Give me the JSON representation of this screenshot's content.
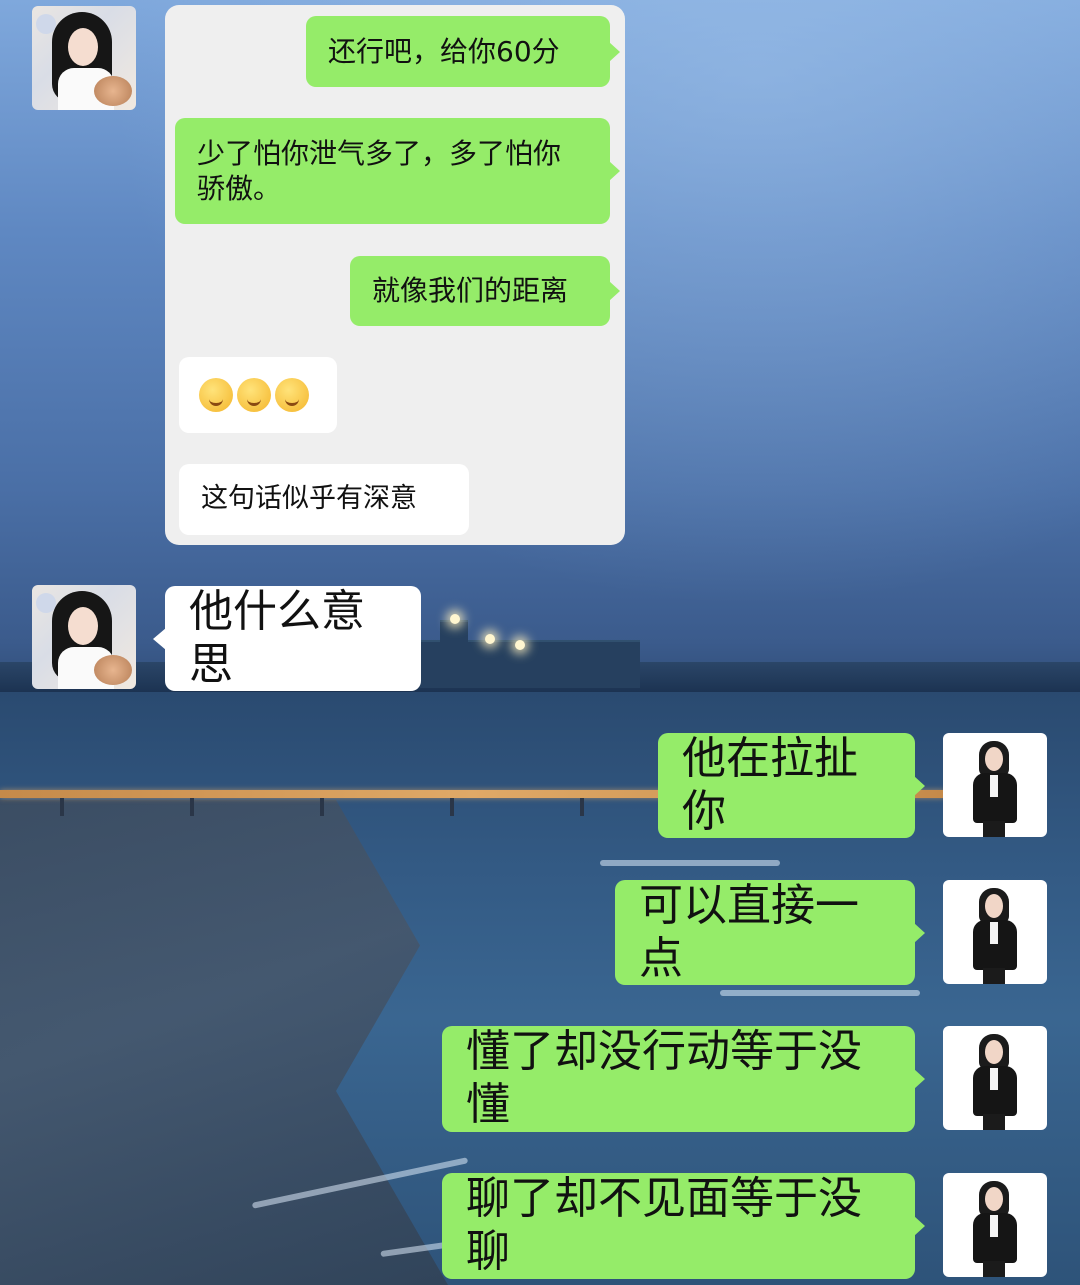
{
  "card_messages": [
    {
      "sender": "self",
      "text": "还行吧，给你60分"
    },
    {
      "sender": "self",
      "text": "少了怕你泄气多了，多了怕你骄傲。"
    },
    {
      "sender": "self",
      "text": "就像我们的距离"
    },
    {
      "sender": "other",
      "emoji_count": 3,
      "emoji_name": "thinking-face-emoji"
    },
    {
      "sender": "other",
      "text": "这句话似乎有深意"
    }
  ],
  "chat": [
    {
      "sender": "other",
      "text": "他什么意思"
    },
    {
      "sender": "self",
      "text": "他在拉扯你"
    },
    {
      "sender": "self",
      "text": "可以直接一点"
    },
    {
      "sender": "self",
      "text": "懂了却没行动等于没懂"
    },
    {
      "sender": "self",
      "text": "聊了却不见面等于没聊"
    }
  ],
  "colors": {
    "bubble_self": "#95ec69",
    "bubble_other": "#ffffff",
    "card_bg": "#efefef"
  }
}
